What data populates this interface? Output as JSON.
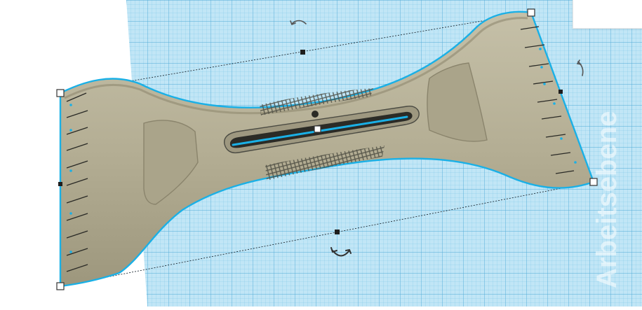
{
  "workplane": {
    "label": "Arbeitsebene",
    "color": "#a8dcf2",
    "grid_color": "#5fb5de"
  },
  "object": {
    "name": "scraper-tool",
    "body_color": "#b4ae94",
    "outline_color": "#1ab0e6"
  },
  "icons": {
    "rotate": "rotate-arrow-icon",
    "handle": "resize-handle-icon"
  }
}
